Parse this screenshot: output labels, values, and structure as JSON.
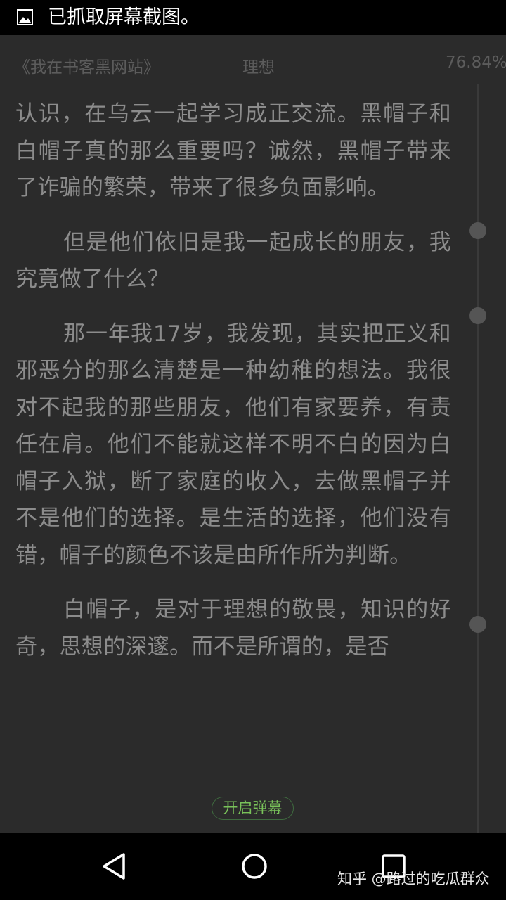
{
  "status_bar": {
    "icon": "image-icon",
    "text": "已抓取屏幕截图。"
  },
  "reader_header": {
    "book_title": "《我在书客黑网站》",
    "chapter_title": "理想",
    "progress": "76.84%"
  },
  "content": {
    "paragraphs": [
      "认识，在乌云一起学习成正交流。黑帽子和白帽子真的那么重要吗？诚然，黑帽子带来了诈骗的繁荣，带来了很多负面影响。",
      "但是他们依旧是我一起成长的朋友，我究竟做了什么？",
      "那一年我17岁，我发现，其实把正义和邪恶分的那么清楚是一种幼稚的想法。我很对不起我的那些朋友，他们有家要养，有责任在肩。他们不能就这样不明不白的因为白帽子入狱，断了家庭的收入，去做黑帽子并不是他们的选择。是生活的选择，他们没有错，帽子的颜色不该是由所作所为判断。",
      "白帽子，是对于理想的敬畏，知识的好奇，思想的深邃。而不是所谓的，是否"
    ]
  },
  "danmaku_button": {
    "label": "开启弹幕"
  },
  "nav_bar": {
    "back": "back-icon",
    "home": "home-icon",
    "recent": "recent-apps-icon"
  },
  "watermark": {
    "text": "知乎 @路过的吃瓜群众"
  },
  "colors": {
    "background": "#2b2b2b",
    "text": "#8c8c8c",
    "header_text": "#5c5c5c",
    "accent_green": "#79c25a",
    "bars": "#000000"
  }
}
